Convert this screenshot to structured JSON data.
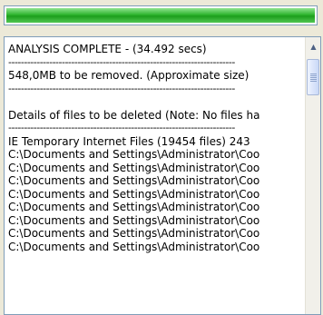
{
  "progress": {
    "value": 100,
    "color": "#2fb52f"
  },
  "results": {
    "header_line": "ANALYSIS COMPLETE - (34.492 secs)",
    "separator": "------------------------------------------------------------------------",
    "size_line": "548,0MB to be removed. (Approximate size)",
    "details_line": "Details of files to be deleted (Note: No files ha",
    "items": [
      "IE Temporary Internet Files (19454 files) 243",
      "C:\\Documents and Settings\\Administrator\\Coo",
      "C:\\Documents and Settings\\Administrator\\Coo",
      "C:\\Documents and Settings\\Administrator\\Coo",
      "C:\\Documents and Settings\\Administrator\\Coo",
      "C:\\Documents and Settings\\Administrator\\Coo",
      "C:\\Documents and Settings\\Administrator\\Coo",
      "C:\\Documents and Settings\\Administrator\\Coo",
      "C:\\Documents and Settings\\Administrator\\Coo"
    ]
  },
  "scrollbar": {
    "up_arrow_icon": "scroll-up-arrow-icon",
    "thumb_grip_icon": "scroll-grip-icon"
  }
}
